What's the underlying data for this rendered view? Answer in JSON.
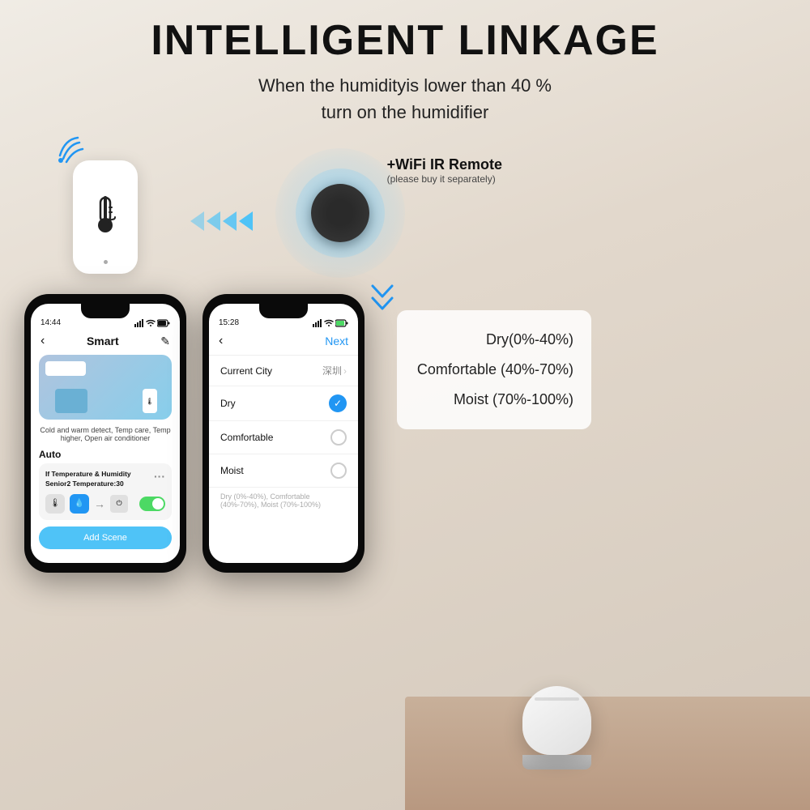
{
  "page": {
    "title": "INTELLIGENT LINKAGE",
    "subtitle_line1": "When the humidityis lower than 40 %",
    "subtitle_line2": "turn on the humidifier"
  },
  "ir_remote": {
    "label": "+WiFi IR Remote",
    "sublabel": "(please buy it separately)"
  },
  "phone1": {
    "status_time": "14:44",
    "smart_label": "Smart",
    "caption": "Cold and warm detect, Temp care, Temp higher,\nOpen air conditioner",
    "auto_label": "Auto",
    "auto_card_title": "If Temperature & Humidity Senior2\nTemperature:30",
    "add_scene": "Add Scene"
  },
  "phone2": {
    "status_time": "15:28",
    "next_label": "Next",
    "current_city_label": "Current City",
    "current_city_value": "深圳",
    "dry_label": "Dry",
    "comfortable_label": "Comfortable",
    "moist_label": "Moist",
    "hint": "Dry (0%-40%), Comfortable (40%-70%), Moist (70%-100%)"
  },
  "humidity_levels": [
    {
      "text": "Dry(0%-40%)"
    },
    {
      "text": "Comfortable (40%-70%)"
    },
    {
      "text": "Moist (70%-100%)"
    }
  ]
}
